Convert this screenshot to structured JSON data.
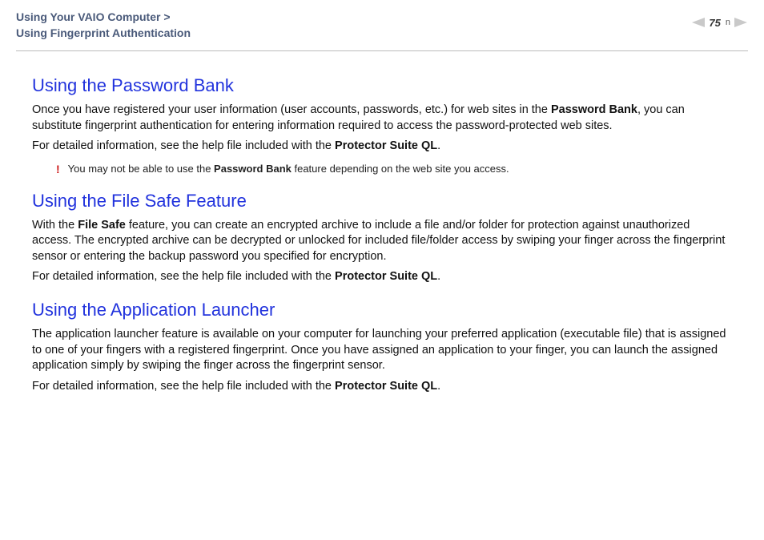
{
  "header": {
    "breadcrumb_line1": "Using Your VAIO Computer >",
    "breadcrumb_line2": "Using Fingerprint Authentication",
    "page_number": "75"
  },
  "sections": [
    {
      "heading": "Using the Password Bank",
      "para1_pre": "Once you have registered your user information (user accounts, passwords, etc.) for web sites in the ",
      "para1_bold": "Password Bank",
      "para1_post": ", you can substitute fingerprint authentication for entering information required to access the password-protected web sites.",
      "para2_pre": "For detailed information, see the help file included with the ",
      "para2_bold": "Protector Suite QL",
      "para2_post": ".",
      "note_bang": "!",
      "note_pre": "You may not be able to use the ",
      "note_bold": "Password Bank",
      "note_post": " feature depending on the web site you access."
    },
    {
      "heading": "Using the File Safe Feature",
      "para1_pre": "With the ",
      "para1_bold": "File Safe",
      "para1_post": " feature, you can create an encrypted archive to include a file and/or folder for protection against unauthorized access. The encrypted archive can be decrypted or unlocked for included file/folder access by swiping your finger across the fingerprint sensor or entering the backup password you specified for encryption.",
      "para2_pre": "For detailed information, see the help file included with the ",
      "para2_bold": "Protector Suite QL",
      "para2_post": "."
    },
    {
      "heading": "Using the Application Launcher",
      "para1_pre": "",
      "para1_bold": "",
      "para1_post": "The application launcher feature is available on your computer for launching your preferred application (executable file) that is assigned to one of your fingers with a registered fingerprint. Once you have assigned an application to your finger, you can launch the assigned application simply by swiping the finger across the fingerprint sensor.",
      "para2_pre": "For detailed information, see the help file included with the ",
      "para2_bold": "Protector Suite QL",
      "para2_post": "."
    }
  ]
}
